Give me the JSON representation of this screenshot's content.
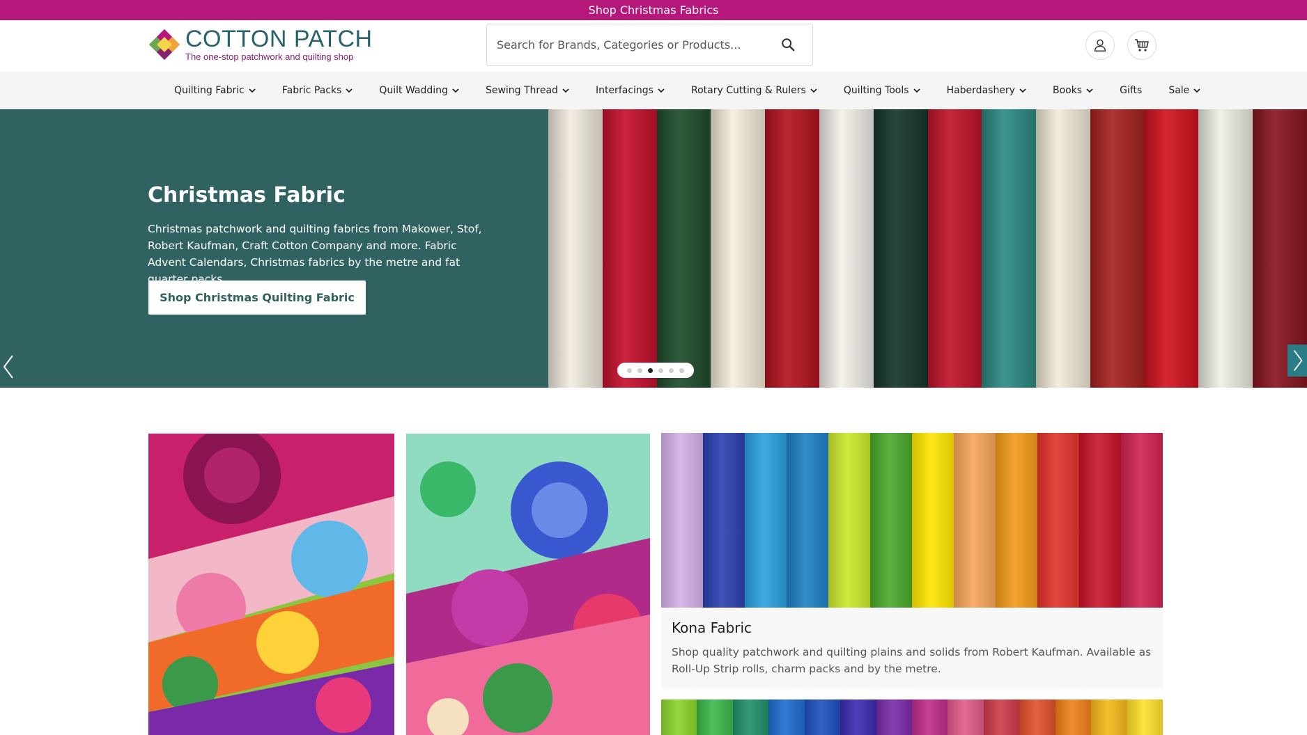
{
  "promo": {
    "text": "Shop Christmas Fabrics"
  },
  "header": {
    "logo_title": "COTTON PATCH",
    "logo_tagline": "The one-stop patchwork and quilting shop",
    "search_placeholder": "Search for Brands, Categories or Products..."
  },
  "nav": {
    "items": [
      {
        "label": "Quilting Fabric",
        "has_dropdown": true
      },
      {
        "label": "Fabric Packs",
        "has_dropdown": true
      },
      {
        "label": "Quilt Wadding",
        "has_dropdown": true
      },
      {
        "label": "Sewing Thread",
        "has_dropdown": true
      },
      {
        "label": "Interfacings",
        "has_dropdown": true
      },
      {
        "label": "Rotary Cutting & Rulers",
        "has_dropdown": true
      },
      {
        "label": "Quilting Tools",
        "has_dropdown": true
      },
      {
        "label": "Haberdashery",
        "has_dropdown": true
      },
      {
        "label": "Books",
        "has_dropdown": true
      },
      {
        "label": "Gifts",
        "has_dropdown": false
      },
      {
        "label": "Sale",
        "has_dropdown": true
      }
    ]
  },
  "hero": {
    "title": "Christmas Fabric",
    "text": "Christmas patchwork and quilting fabrics from Makower, Stof, Robert Kaufman, Craft Cotton Company and more. Fabric Advent Calendars, Christmas fabrics by the metre and fat quarter packs",
    "cta": "Shop Christmas Quilting Fabric",
    "slide_count": 6,
    "active_slide": 3,
    "bolts": [
      "#f2ece0",
      "#c8102e",
      "#1f4d2b",
      "#f5efdc",
      "#b5141f",
      "#f4f1ea",
      "#17372b",
      "#c3142b",
      "#2d8c85",
      "#f3ecd8",
      "#a8231f",
      "#d4141f",
      "#eef0e4",
      "#8a1620"
    ]
  },
  "card": {
    "title": "Kona Fabric",
    "text": "Shop quality patchwork and quilting plains and solids from Robert Kaufman. Available as Roll-Up Strip rolls, charm packs and by the metre.",
    "swatches": [
      "#d4b0e8",
      "#2a3fb0",
      "#2b9fe0",
      "#1d7fc4",
      "#cbe82a",
      "#4aa82a",
      "#ffe600",
      "#f7a55a",
      "#f39a18",
      "#e4312b",
      "#c8132a",
      "#d02250"
    ]
  },
  "card2": {
    "swatches": [
      "#8ad42a",
      "#3bb84a",
      "#1f8f6a",
      "#1c6bd0",
      "#1d4fc0",
      "#3a2ab0",
      "#7a2aa8",
      "#c02a8a",
      "#e05a8a",
      "#d03a4a",
      "#e0502a",
      "#f0801a",
      "#f5b81a",
      "#ffe02a"
    ]
  },
  "colors": {
    "brand_magenta": "#b5177a",
    "hero_teal": "#2f6260"
  }
}
